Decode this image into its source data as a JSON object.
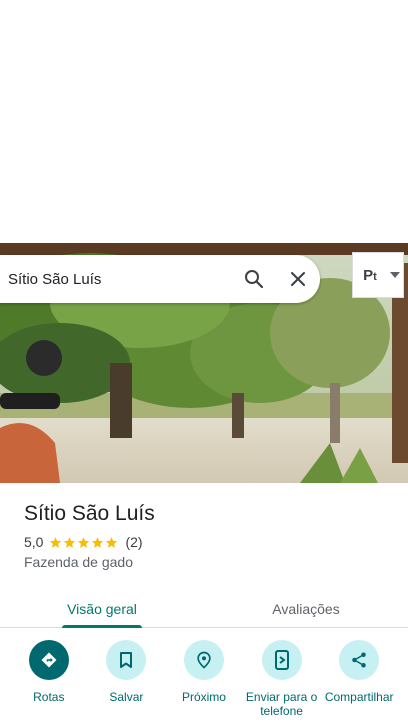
{
  "search": {
    "query": "Sítio São Luís"
  },
  "icons": {
    "search": "search-icon",
    "clear": "close-icon",
    "layers": "layers-icon",
    "star": "star-icon"
  },
  "place": {
    "name": "Sítio São Luís",
    "rating": "5,0",
    "star_count": 5,
    "review_count": "(2)",
    "category": "Fazenda de gado"
  },
  "tabs": [
    {
      "label": "Visão geral",
      "active": true
    },
    {
      "label": "Avaliações",
      "active": false
    }
  ],
  "actions": [
    {
      "label": "Rotas",
      "icon": "directions-icon"
    },
    {
      "label": "Salvar",
      "icon": "bookmark-icon"
    },
    {
      "label": "Próximo",
      "icon": "nearby-icon"
    },
    {
      "label": "Enviar para o telefone",
      "icon": "send-to-phone-icon"
    },
    {
      "label": "Compartilhar",
      "icon": "share-icon"
    }
  ],
  "colors": {
    "accent": "#00796b",
    "action_primary": "#00686f",
    "action_secondary_bg": "#c7f0f2",
    "star": "#fbbc04"
  }
}
